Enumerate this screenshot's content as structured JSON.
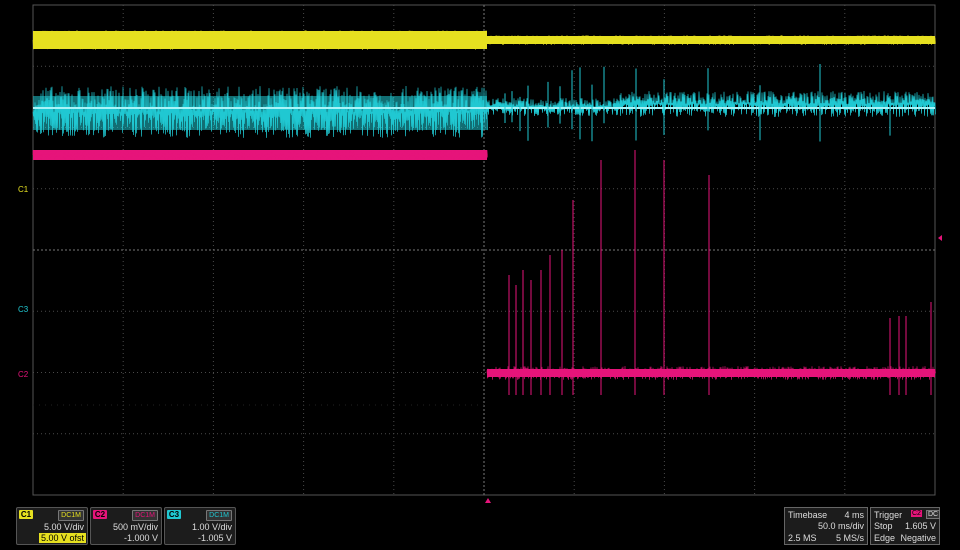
{
  "colors": {
    "c1": "#e6e020",
    "c2": "#e6147a",
    "c3": "#20c8d2",
    "grid": "#4a4a4a",
    "background": "#000000"
  },
  "markers": {
    "c1": "C1",
    "c3": "C3",
    "c2": "C2"
  },
  "channels": [
    {
      "tag": "C1",
      "coupling": "DC1M",
      "vdiv": "5.00 V/div",
      "offset": "5.00 V ofst"
    },
    {
      "tag": "C2",
      "coupling": "DC1M",
      "vdiv": "500 mV/div",
      "offset": "-1.000 V"
    },
    {
      "tag": "C3",
      "coupling": "DC1M",
      "vdiv": "1.00 V/div",
      "offset": "-1.005 V"
    }
  ],
  "timebase": {
    "label": "Timebase",
    "delay": "4 ms",
    "tdiv": "50.0 ms/div",
    "samples": "2.5 MS",
    "rate": "5 MS/s"
  },
  "trigger": {
    "label": "Trigger",
    "source": "C2",
    "coupling": "DC",
    "mode": "Stop",
    "level": "1.605 V",
    "type": "Edge",
    "slope": "Negative"
  }
}
